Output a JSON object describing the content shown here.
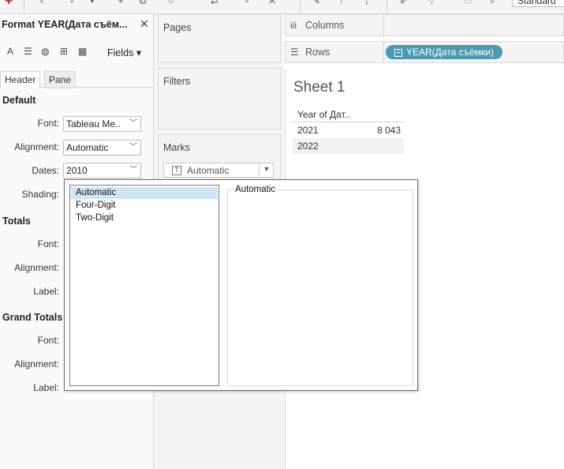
{
  "toolbar": {
    "view_size": "Standard"
  },
  "format_pane": {
    "title": "Format YEAR(Дата съём...",
    "fields_label": "Fields",
    "tabs": {
      "header": "Header",
      "pane": "Pane"
    },
    "default": {
      "heading": "Default",
      "font_label": "Font:",
      "font_value": "Tableau Me..",
      "alignment_label": "Alignment:",
      "alignment_value": "Automatic",
      "dates_label": "Dates:",
      "dates_value": "2010",
      "shading_label": "Shading:"
    },
    "totals": {
      "heading": "Totals",
      "font_label": "Font:",
      "alignment_label": "Alignment:",
      "label_label": "Label:"
    },
    "grand_totals": {
      "heading": "Grand Totals",
      "font_label": "Font:",
      "alignment_label": "Alignment:",
      "label_label": "Label:"
    }
  },
  "shelves": {
    "pages": "Pages",
    "filters": "Filters",
    "marks": "Marks",
    "marks_type": "Automatic",
    "columns": "Columns",
    "rows": "Rows",
    "rows_pill": "YEAR(Дата съёмки)"
  },
  "sheet": {
    "title": "Sheet 1",
    "header": "Year of Дат..",
    "rows": [
      {
        "year": "2021",
        "value": "8 043"
      },
      {
        "year": "2022",
        "value": ""
      }
    ]
  },
  "dates_dropdown": {
    "options": [
      "Automatic",
      "Four-Digit",
      "Two-Digit"
    ],
    "selected": "Automatic",
    "preview_title": "Automatic"
  },
  "colors": {
    "pill": "#4a9bb3",
    "selection": "#cfe6f7"
  }
}
